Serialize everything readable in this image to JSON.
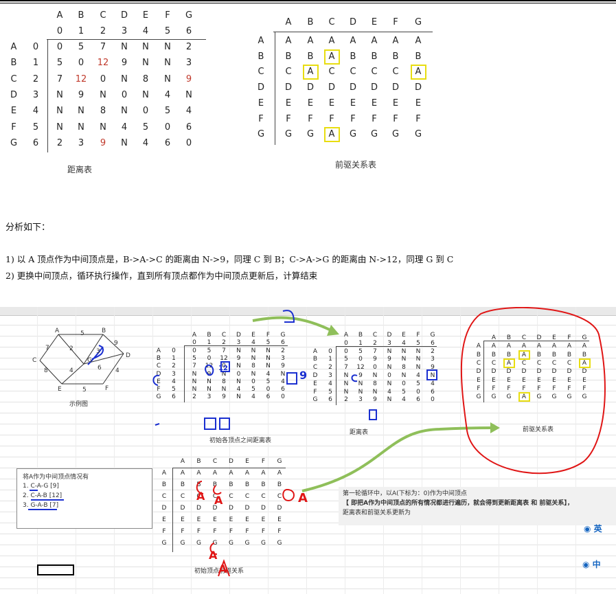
{
  "top": {
    "dist_cols": [
      "A",
      "B",
      "C",
      "D",
      "E",
      "F",
      "G"
    ],
    "dist_idx": [
      "0",
      "1",
      "2",
      "3",
      "4",
      "5",
      "6"
    ],
    "dist_rows": [
      {
        "label": "A",
        "idx": "0",
        "vals": [
          "0",
          "5",
          "7",
          "N",
          "N",
          "N",
          "2"
        ]
      },
      {
        "label": "B",
        "idx": "1",
        "vals": [
          "5",
          "0",
          "12",
          "9",
          "N",
          "N",
          "3"
        ]
      },
      {
        "label": "C",
        "idx": "2",
        "vals": [
          "7",
          "12",
          "0",
          "N",
          "8",
          "N",
          "9"
        ]
      },
      {
        "label": "D",
        "idx": "3",
        "vals": [
          "N",
          "9",
          "N",
          "0",
          "N",
          "4",
          "N"
        ]
      },
      {
        "label": "E",
        "idx": "4",
        "vals": [
          "N",
          "N",
          "8",
          "N",
          "0",
          "5",
          "4"
        ]
      },
      {
        "label": "F",
        "idx": "5",
        "vals": [
          "N",
          "N",
          "N",
          "4",
          "5",
          "0",
          "6"
        ]
      },
      {
        "label": "G",
        "idx": "6",
        "vals": [
          "2",
          "3",
          "9",
          "N",
          "4",
          "6",
          "0"
        ]
      }
    ],
    "dist_caption": "距离表",
    "pred_cols": [
      "A",
      "B",
      "C",
      "D",
      "E",
      "F",
      "G"
    ],
    "pred_rows": [
      {
        "label": "A",
        "vals": [
          "A",
          "A",
          "A",
          "A",
          "A",
          "A",
          "A"
        ]
      },
      {
        "label": "B",
        "vals": [
          "B",
          "B",
          "A",
          "B",
          "B",
          "B",
          "B"
        ]
      },
      {
        "label": "C",
        "vals": [
          "C",
          "A",
          "C",
          "C",
          "C",
          "C",
          "A"
        ]
      },
      {
        "label": "D",
        "vals": [
          "D",
          "D",
          "D",
          "D",
          "D",
          "D",
          "D"
        ]
      },
      {
        "label": "E",
        "vals": [
          "E",
          "E",
          "E",
          "E",
          "E",
          "E",
          "E"
        ]
      },
      {
        "label": "F",
        "vals": [
          "F",
          "F",
          "F",
          "F",
          "F",
          "F",
          "F"
        ]
      },
      {
        "label": "G",
        "vals": [
          "G",
          "G",
          "A",
          "G",
          "G",
          "G",
          "G"
        ]
      }
    ],
    "pred_caption": "前驱关系表"
  },
  "analysis": {
    "heading": "分析如下：",
    "line1": "1)  以 A 顶点作为中间顶点是，B->A->C 的距离由 N->9，同理 C 到 B；C->A->G 的距离由 N->12，同理 G 到 C",
    "line2": "2)  更换中间顶点，循环执行操作，直到所有顶点都作为中间顶点更新后，计算结束"
  },
  "sheet": {
    "graph": {
      "nodes": [
        "A",
        "B",
        "C",
        "D",
        "E",
        "F",
        "G"
      ],
      "weights": [
        "5",
        "7",
        "2",
        "9",
        "8",
        "4",
        "3",
        "6",
        "4",
        "5"
      ],
      "caption": "示例图"
    },
    "init_dist_caption": "初始各顶点之间距离表",
    "after_dist_rows": [
      {
        "label": "A",
        "idx": "0",
        "vals": [
          "0",
          "5",
          "7",
          "N",
          "N",
          "N",
          "2"
        ]
      },
      {
        "label": "B",
        "idx": "1",
        "vals": [
          "5",
          "0",
          "9",
          "9",
          "N",
          "N",
          "3"
        ]
      },
      {
        "label": "C",
        "idx": "2",
        "vals": [
          "7",
          "12",
          "0",
          "N",
          "8",
          "N",
          "9"
        ]
      },
      {
        "label": "D",
        "idx": "3",
        "vals": [
          "N",
          "9",
          "N",
          "0",
          "N",
          "4",
          "N"
        ]
      },
      {
        "label": "E",
        "idx": "4",
        "vals": [
          "N",
          "N",
          "8",
          "N",
          "0",
          "5",
          "4"
        ]
      },
      {
        "label": "F",
        "idx": "5",
        "vals": [
          "N",
          "N",
          "N",
          "4",
          "5",
          "0",
          "6"
        ]
      },
      {
        "label": "G",
        "idx": "6",
        "vals": [
          "2",
          "3",
          "9",
          "N",
          "4",
          "6",
          "0"
        ]
      }
    ],
    "after_dist_caption": "距离表",
    "after_pred_caption": "前驱关系表",
    "init_pred_caption": "初始顶点前驱关系",
    "init_pred_rows": [
      {
        "label": "A",
        "vals": [
          "A",
          "A",
          "A",
          "A",
          "A",
          "A",
          "A"
        ]
      },
      {
        "label": "B",
        "vals": [
          "B",
          "B",
          "B",
          "B",
          "B",
          "B",
          "B"
        ]
      },
      {
        "label": "C",
        "vals": [
          "C",
          "C",
          "C",
          "C",
          "C",
          "C",
          "C"
        ]
      },
      {
        "label": "D",
        "vals": [
          "D",
          "D",
          "D",
          "D",
          "D",
          "D",
          "D"
        ]
      },
      {
        "label": "E",
        "vals": [
          "E",
          "E",
          "E",
          "E",
          "E",
          "E",
          "E"
        ]
      },
      {
        "label": "F",
        "vals": [
          "F",
          "F",
          "F",
          "F",
          "F",
          "F",
          "F"
        ]
      },
      {
        "label": "G",
        "vals": [
          "G",
          "G",
          "G",
          "G",
          "G",
          "G",
          "G"
        ]
      }
    ],
    "note_box": {
      "title": "将A作为中间顶点情况有",
      "items": [
        "1. C-A-G [9]",
        "2. C-A-B [12]",
        "3. G-A-B [7]"
      ]
    },
    "round_note": {
      "line1": "第一轮循环中，以A(下标为：0)作为中间顶点",
      "line2": "【 即把A作为中间顶点的所有情况都进行遍历，就会得到更新距离表 和 前驱关系】，",
      "line3": "距离表和前驱关系更新为"
    },
    "ime": [
      "英",
      "中"
    ],
    "ink_letters": [
      "A",
      "A",
      "A",
      "A",
      "A",
      "9",
      "12"
    ]
  }
}
